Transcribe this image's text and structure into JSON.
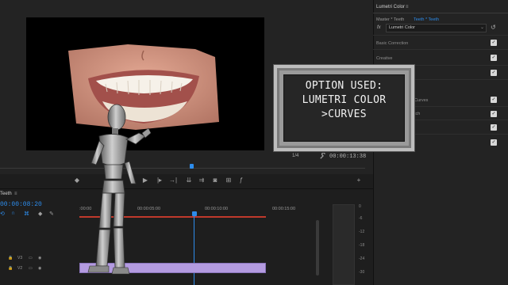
{
  "monitor": {
    "resolution": "1/4",
    "timecode": "00:00:13:38"
  },
  "lumetri": {
    "tab_title": "Lumetri Color",
    "tab_menu": "≡",
    "master_label": "Master * Teeth",
    "clip_label": "Teeth * Teeth",
    "fx_label": "fx",
    "effect_name": "Lumetri Color",
    "sections": [
      {
        "label": "Basic Correction",
        "checked": true
      },
      {
        "label": "Creative",
        "checked": true
      },
      {
        "label": "",
        "checked": true
      },
      {
        "label": "Curves",
        "checked": true
      },
      {
        "label": "tch",
        "checked": true
      },
      {
        "label": "",
        "checked": true
      },
      {
        "label": "",
        "checked": true
      }
    ]
  },
  "overlay": {
    "line1": "OPTION USED:",
    "line2": "LUMETRI COLOR",
    "line3": ">CURVES"
  },
  "timeline": {
    "sequence_name": "Teeth",
    "sequence_menu": "≡",
    "timecode": "00:00:08:20",
    "ruler": ":00:00",
    "ruler_ticks": [
      "00:00:05:00",
      "00:00:10:00",
      "00:00:15:00"
    ],
    "tracks": [
      "V3",
      "V2"
    ],
    "meter_db": [
      "0",
      "-6",
      "-12",
      "-18",
      "-24",
      "-30"
    ]
  },
  "colors": {
    "accent": "#2d8ceb",
    "work_area": "#c0392b",
    "clip": "#b49be0"
  }
}
